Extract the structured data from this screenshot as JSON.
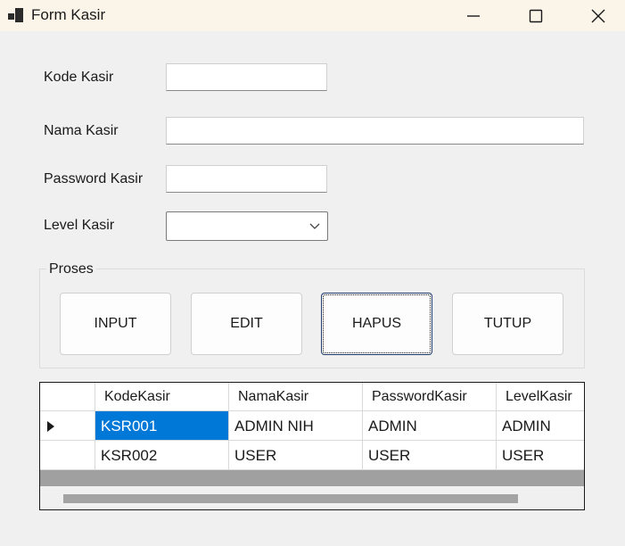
{
  "window": {
    "title": "Form Kasir"
  },
  "form": {
    "kode_label": "Kode Kasir",
    "kode_value": "",
    "nama_label": "Nama Kasir",
    "nama_value": "",
    "password_label": "Password Kasir",
    "password_value": "",
    "level_label": "Level Kasir",
    "level_value": ""
  },
  "proses": {
    "title": "Proses",
    "buttons": [
      "INPUT",
      "EDIT",
      "HAPUS",
      "TUTUP"
    ]
  },
  "grid": {
    "columns": [
      "KodeKasir",
      "NamaKasir",
      "PasswordKasir",
      "LevelKasir"
    ],
    "rows": [
      [
        "KSR001",
        "ADMIN NIH",
        "ADMIN",
        "ADMIN"
      ],
      [
        "KSR002",
        "USER",
        "USER",
        "USER"
      ]
    ]
  }
}
